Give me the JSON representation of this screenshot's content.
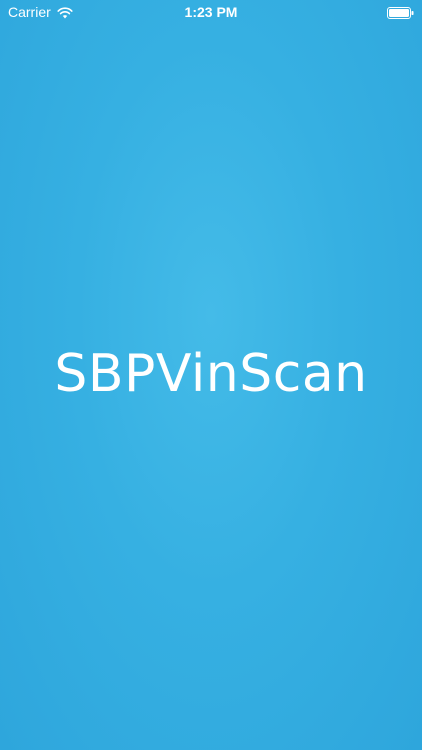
{
  "status_bar": {
    "carrier": "Carrier",
    "time": "1:23 PM",
    "wifi_icon": "wifi-icon",
    "battery_icon": "battery-icon"
  },
  "splash": {
    "title": "SBPVinScan",
    "background_color": "#36b0e2",
    "text_color": "#ffffff"
  }
}
